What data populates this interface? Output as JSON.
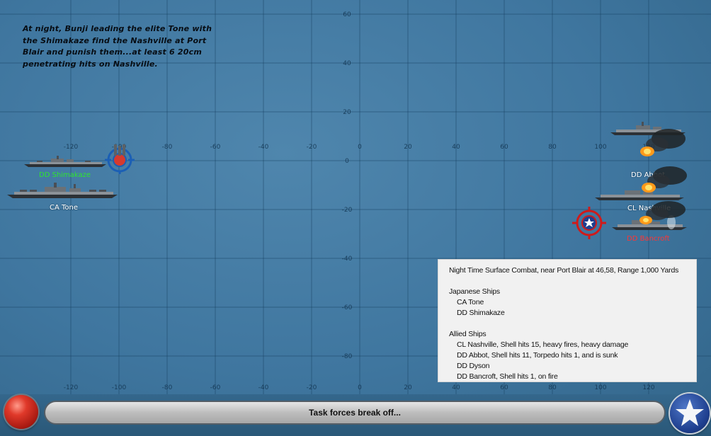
{
  "narration": "At night, Bunji leading the elite Tone with the Shimakaze find the Nashville at Port Blair and punish them...at least 6 20cm penetrating hits on Nashville.",
  "map": {
    "x_ticks": [
      "-120",
      "-100",
      "-80",
      "-60",
      "-40",
      "-20",
      "0",
      "20",
      "40",
      "60",
      "80",
      "100",
      "120"
    ],
    "y_ticks": [
      "60",
      "40",
      "20",
      "0",
      "-20",
      "-40",
      "-60",
      "-80"
    ]
  },
  "ships": {
    "shimakaze": {
      "label": "DD Shimakaze",
      "side": "japanese"
    },
    "tone": {
      "label": "CA Tone",
      "side": "japanese"
    },
    "dyson": {
      "label": "DD Dyson",
      "side": "allied"
    },
    "abbot": {
      "label": "DD Abbot",
      "side": "allied"
    },
    "nashville": {
      "label": "CL Nashville",
      "side": "allied"
    },
    "bancroft": {
      "label": "DD Bancroft",
      "side": "allied"
    }
  },
  "colors": {
    "label_default": "#ffffff",
    "label_japanese_active": "#2ee62e",
    "label_allied_target": "#ff3535",
    "target_japanese": "#1b5fb5",
    "target_allied": "#d01a1a"
  },
  "report": {
    "title": "Night Time Surface Combat, near Port Blair at 46,58, Range 1,000 Yards",
    "japanese_header": "Japanese Ships",
    "japanese_ships": [
      "CA Tone",
      "DD Shimakaze"
    ],
    "allied_header": "Allied Ships",
    "allied_ships": [
      "CL Nashville, Shell hits 15,  heavy fires,  heavy damage",
      "DD Abbot, Shell hits 11, Torpedo hits 1, and is sunk",
      "DD Dyson",
      "DD Bancroft, Shell hits 1,  on fire"
    ]
  },
  "status_text": "Task forces break off...",
  "icons": {
    "left_button": "red-button",
    "right_button": "allied-star-icon"
  }
}
